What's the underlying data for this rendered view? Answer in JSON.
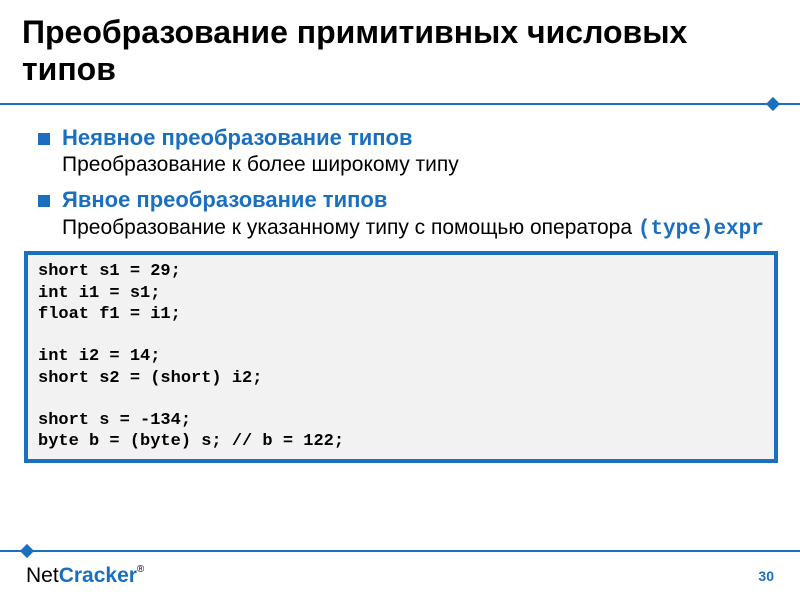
{
  "title": "Преобразование примитивных числовых типов",
  "bullets": [
    {
      "heading": "Неявное преобразование типов",
      "sub": "Преобразование к более широкому типу"
    },
    {
      "heading": "Явное преобразование типов",
      "sub": "Преобразование к указанному типу с помощью оператора ",
      "code_inline": "(type)expr"
    }
  ],
  "code": "short s1 = 29;\nint i1 = s1;\nfloat f1 = i1;\n\nint i2 = 14;\nshort s2 = (short) i2;\n\nshort s = -134;\nbyte b = (byte) s; // b = 122;",
  "footer": {
    "logo_net": "Net",
    "logo_cracker": "Cracker",
    "reg": "®",
    "page": "30"
  }
}
